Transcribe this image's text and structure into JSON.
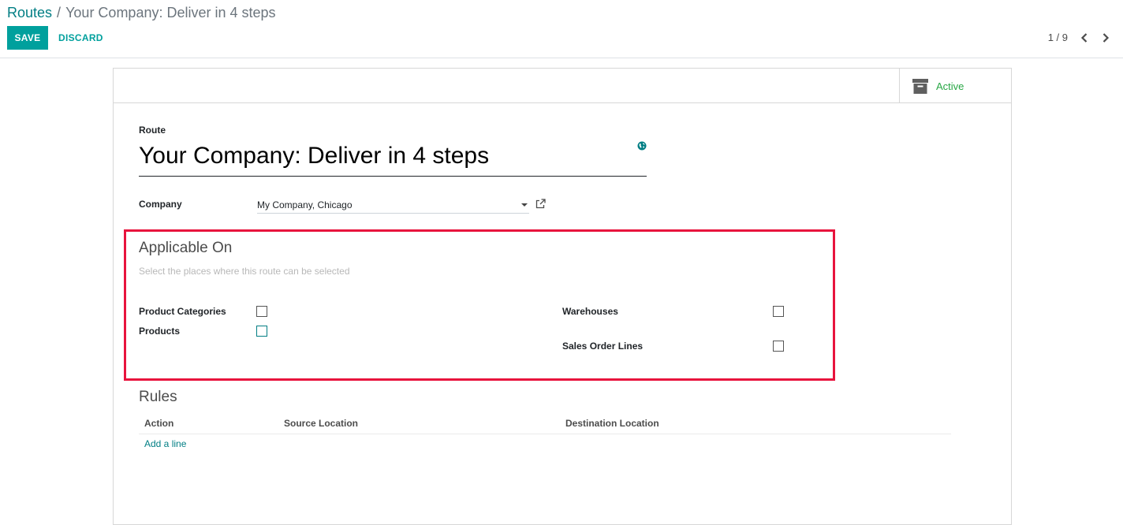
{
  "breadcrumb": {
    "parent": "Routes",
    "separator": "/",
    "current": "Your Company: Deliver in 4 steps"
  },
  "toolbar": {
    "save_label": "SAVE",
    "discard_label": "DISCARD"
  },
  "pager": {
    "value": "1 / 9"
  },
  "status": {
    "active_label": "Active"
  },
  "form": {
    "route_label": "Route",
    "route_name": "Your Company: Deliver in 4 steps",
    "company_label": "Company",
    "company_value": "My Company, Chicago"
  },
  "applicable_on": {
    "title": "Applicable On",
    "help": "Select the places where this route can be selected",
    "product_categories": "Product Categories",
    "products": "Products",
    "warehouses": "Warehouses",
    "sales_order_lines": "Sales Order Lines"
  },
  "rules": {
    "title": "Rules",
    "columns": [
      "Action",
      "Source Location",
      "Destination Location"
    ],
    "add_line": "Add a line"
  },
  "colors": {
    "accent": "#00a09d",
    "link": "#017e84",
    "active": "#28a745",
    "highlight": "#e8143d"
  }
}
